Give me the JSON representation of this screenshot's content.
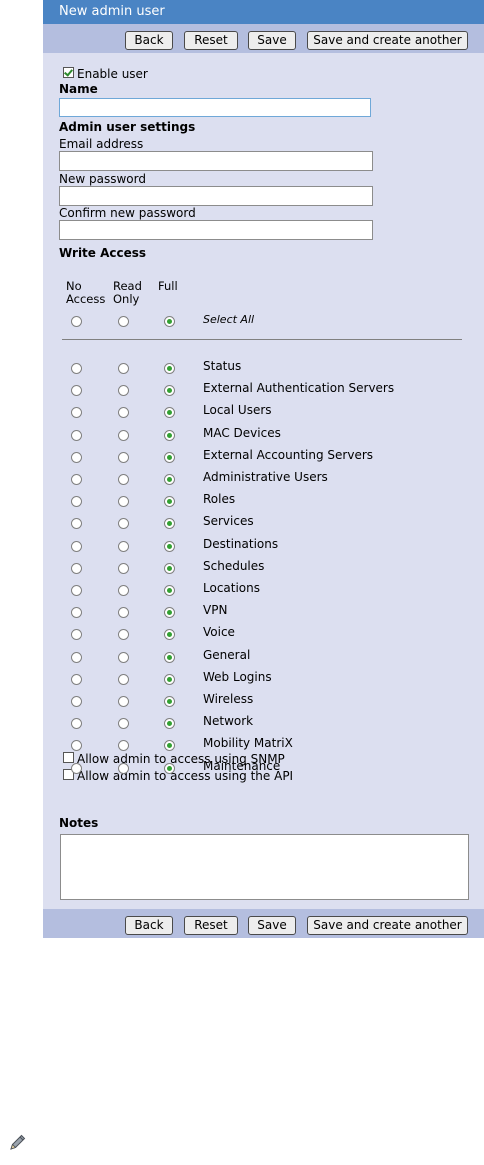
{
  "title": "New admin user",
  "buttons": {
    "back": "Back",
    "reset": "Reset",
    "save": "Save",
    "save_another": "Save and create another"
  },
  "enable_user": {
    "label": "Enable user",
    "checked": true
  },
  "name": {
    "label": "Name",
    "value": ""
  },
  "admin_settings": {
    "heading": "Admin user settings",
    "email_label": "Email address",
    "email_value": "",
    "new_password_label": "New password",
    "new_password_value": "",
    "confirm_password_label": "Confirm new password",
    "confirm_password_value": ""
  },
  "write_access": {
    "heading": "Write Access",
    "columns": [
      {
        "line1": "No",
        "line2": "Access"
      },
      {
        "line1": "Read",
        "line2": "Only"
      },
      {
        "line1": "Full",
        "line2": ""
      }
    ],
    "select_all": {
      "label": "Select All",
      "value": "full"
    },
    "items": [
      {
        "label": "Status",
        "value": "full"
      },
      {
        "label": "External Authentication Servers",
        "value": "full"
      },
      {
        "label": "Local Users",
        "value": "full"
      },
      {
        "label": "MAC Devices",
        "value": "full"
      },
      {
        "label": "External Accounting Servers",
        "value": "full"
      },
      {
        "label": "Administrative Users",
        "value": "full"
      },
      {
        "label": "Roles",
        "value": "full"
      },
      {
        "label": "Services",
        "value": "full"
      },
      {
        "label": "Destinations",
        "value": "full"
      },
      {
        "label": "Schedules",
        "value": "full"
      },
      {
        "label": "Locations",
        "value": "full"
      },
      {
        "label": "VPN",
        "value": "full"
      },
      {
        "label": "Voice",
        "value": "full"
      },
      {
        "label": "General",
        "value": "full"
      },
      {
        "label": "Web Logins",
        "value": "full"
      },
      {
        "label": "Wireless",
        "value": "full"
      },
      {
        "label": "Network",
        "value": "full"
      },
      {
        "label": "Mobility MatriX",
        "value": "full"
      },
      {
        "label": "Maintenance",
        "value": "full"
      }
    ]
  },
  "options": [
    {
      "label": "Allow admin to access using SNMP",
      "checked": false
    },
    {
      "label": "Allow admin to access using the API",
      "checked": false
    }
  ],
  "notes": {
    "label": "Notes",
    "value": ""
  },
  "icons": {
    "edit": "pencil-icon"
  },
  "colors": {
    "title_bar": "#4a84c4",
    "button_bar": "#b4bedf",
    "panel": "#dcdff0",
    "radio_selected": "#33a033"
  }
}
